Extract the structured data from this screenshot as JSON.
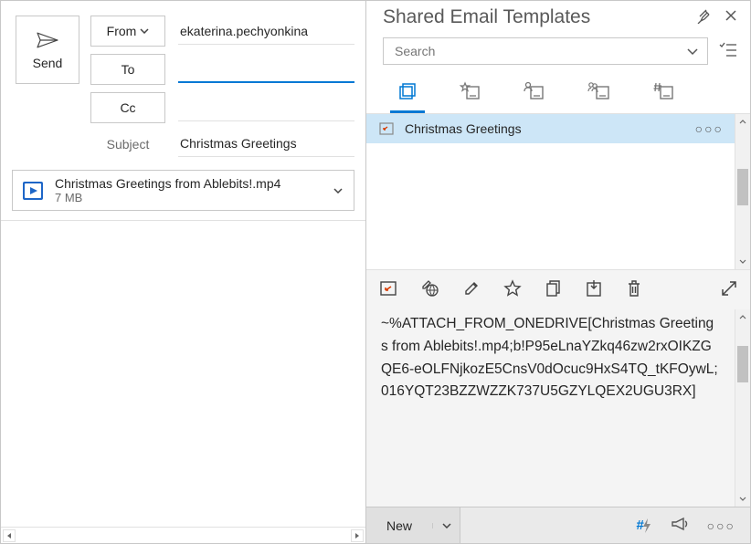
{
  "compose": {
    "send_label": "Send",
    "from_label": "From",
    "to_label": "To",
    "cc_label": "Cc",
    "subject_label": "Subject",
    "from_value": "ekaterina.pechyonkina",
    "to_value": "",
    "cc_value": "",
    "subject_value": "Christmas Greetings",
    "attachment": {
      "name": "Christmas Greetings from Ablebits!.mp4",
      "size": "7 MB"
    }
  },
  "templates": {
    "title": "Shared Email Templates",
    "search_placeholder": "Search",
    "list": {
      "selected": {
        "label": "Christmas Greetings"
      }
    },
    "preview_text": "~%ATTACH_FROM_ONEDRIVE[Christmas Greetings from Ablebits!.mp4;b!P95eLnaYZkq46zw2rxOIKZGQE6-eOLFNjkozE5CnsV0dOcuc9HxS4TQ_tKFOywL;016YQT23BZZWZZK737U5GZYLQEX2UGU3RX]",
    "new_label": "New"
  }
}
